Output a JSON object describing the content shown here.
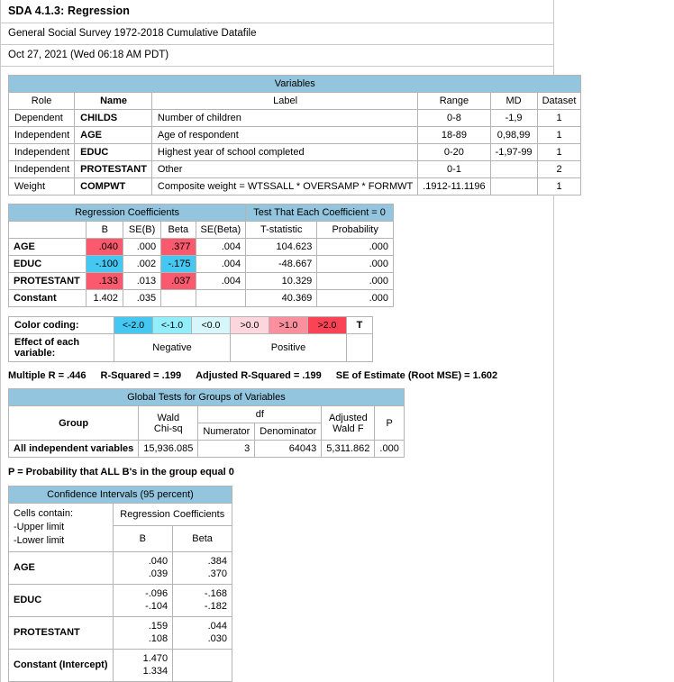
{
  "header": {
    "title": "SDA 4.1.3: Regression",
    "subtitle": "General Social Survey 1972-2018 Cumulative Datafile",
    "date": "Oct 27, 2021 (Wed 06:18 AM PDT)"
  },
  "colors": {
    "caption_blue": "#93c6de",
    "positive_strong": "#fb5a6e",
    "negative_strong": "#44c8f2",
    "grid": "#b4b4b4"
  },
  "variables_table": {
    "caption": "Variables",
    "columns": [
      "Role",
      "Name",
      "Label",
      "Range",
      "MD",
      "Dataset"
    ],
    "rows": [
      {
        "role": "Dependent",
        "name": "CHILDS",
        "label": "Number of children",
        "range": "0-8",
        "md": "-1,9",
        "dataset": "1"
      },
      {
        "role": "Independent",
        "name": "AGE",
        "label": "Age of respondent",
        "range": "18-89",
        "md": "0,98,99",
        "dataset": "1"
      },
      {
        "role": "Independent",
        "name": "EDUC",
        "label": "Highest year of school completed",
        "range": "0-20",
        "md": "-1,97-99",
        "dataset": "1"
      },
      {
        "role": "Independent",
        "name": "PROTESTANT",
        "label": "Other",
        "range": "0-1",
        "md": "",
        "dataset": "2"
      },
      {
        "role": "Weight",
        "name": "COMPWT",
        "label": "Composite weight = WTSSALL * OVERSAMP * FORMWT",
        "range": ".1912-11.1196",
        "md": "",
        "dataset": "1"
      }
    ]
  },
  "regression_table": {
    "caption_left": "Regression Coefficients",
    "caption_right": "Test That Each Coefficient = 0",
    "columns": [
      "",
      "B",
      "SE(B)",
      "Beta",
      "SE(Beta)",
      "T-statistic",
      "Probability"
    ],
    "rows": [
      {
        "variable": "AGE",
        "b": ".040",
        "b_hl": "pos",
        "se_b": ".000",
        "beta": ".377",
        "beta_hl": "pos",
        "se_beta": ".004",
        "t": "104.623",
        "p": ".000"
      },
      {
        "variable": "EDUC",
        "b": "-.100",
        "b_hl": "neg",
        "se_b": ".002",
        "beta": "-.175",
        "beta_hl": "neg",
        "se_beta": ".004",
        "t": "-48.667",
        "p": ".000"
      },
      {
        "variable": "PROTESTANT",
        "b": ".133",
        "b_hl": "pos",
        "se_b": ".013",
        "beta": ".037",
        "beta_hl": "pos",
        "se_beta": ".004",
        "t": "10.329",
        "p": ".000"
      },
      {
        "variable": "Constant",
        "b": "1.402",
        "b_hl": "none",
        "se_b": ".035",
        "beta": "",
        "beta_hl": "none",
        "se_beta": "",
        "t": "40.369",
        "p": ".000"
      }
    ]
  },
  "legend": {
    "color_coding_label": "Color coding:",
    "swatches": [
      "<-2.0",
      "<-1.0",
      "<0.0",
      ">0.0",
      ">1.0",
      ">2.0"
    ],
    "t_label": "T",
    "effect_label": "Effect of each variable:",
    "negative": "Negative",
    "positive": "Positive"
  },
  "summary": {
    "multiple_r": "Multiple R = .446",
    "r_squared": "R-Squared = .199",
    "adj_r_squared": "Adjusted R-Squared = .199",
    "se_estimate": "SE of Estimate (Root MSE) = 1.602"
  },
  "global_tests": {
    "caption": "Global Tests for Groups of Variables",
    "col_group": "Group",
    "col_wald": "Wald\nChi-sq",
    "col_wald_line1": "Wald",
    "col_wald_line2": "Chi-sq",
    "col_df": "df",
    "col_numerator": "Numerator",
    "col_denominator": "Denominator",
    "col_adj_line1": "Adjusted",
    "col_adj_line2": "Wald F",
    "col_p": "P",
    "rows": [
      {
        "group": "All independent variables",
        "wald_chisq": "15,936.085",
        "numerator": "3",
        "denominator": "64043",
        "adjusted_wald_f": "5,311.862",
        "p": ".000"
      }
    ],
    "footnote": "P = Probability that ALL B's in the group equal 0"
  },
  "confidence_intervals": {
    "caption": "Confidence Intervals (95 percent)",
    "cells_contain_line1": "Cells contain:",
    "cells_contain_line2": "-Upper limit",
    "cells_contain_line3": "-Lower limit",
    "col_regression_coefficients": "Regression Coefficients",
    "col_b": "B",
    "col_beta": "Beta",
    "rows": [
      {
        "variable": "AGE",
        "b_upper": ".040",
        "b_lower": ".039",
        "beta_upper": ".384",
        "beta_lower": ".370"
      },
      {
        "variable": "EDUC",
        "b_upper": "-.096",
        "b_lower": "-.104",
        "beta_upper": "-.168",
        "beta_lower": "-.182"
      },
      {
        "variable": "PROTESTANT",
        "b_upper": ".159",
        "b_lower": ".108",
        "beta_upper": ".044",
        "beta_lower": ".030"
      },
      {
        "variable": "Constant (Intercept)",
        "b_upper": "1.470",
        "b_lower": "1.334",
        "beta_upper": "",
        "beta_lower": ""
      }
    ]
  }
}
